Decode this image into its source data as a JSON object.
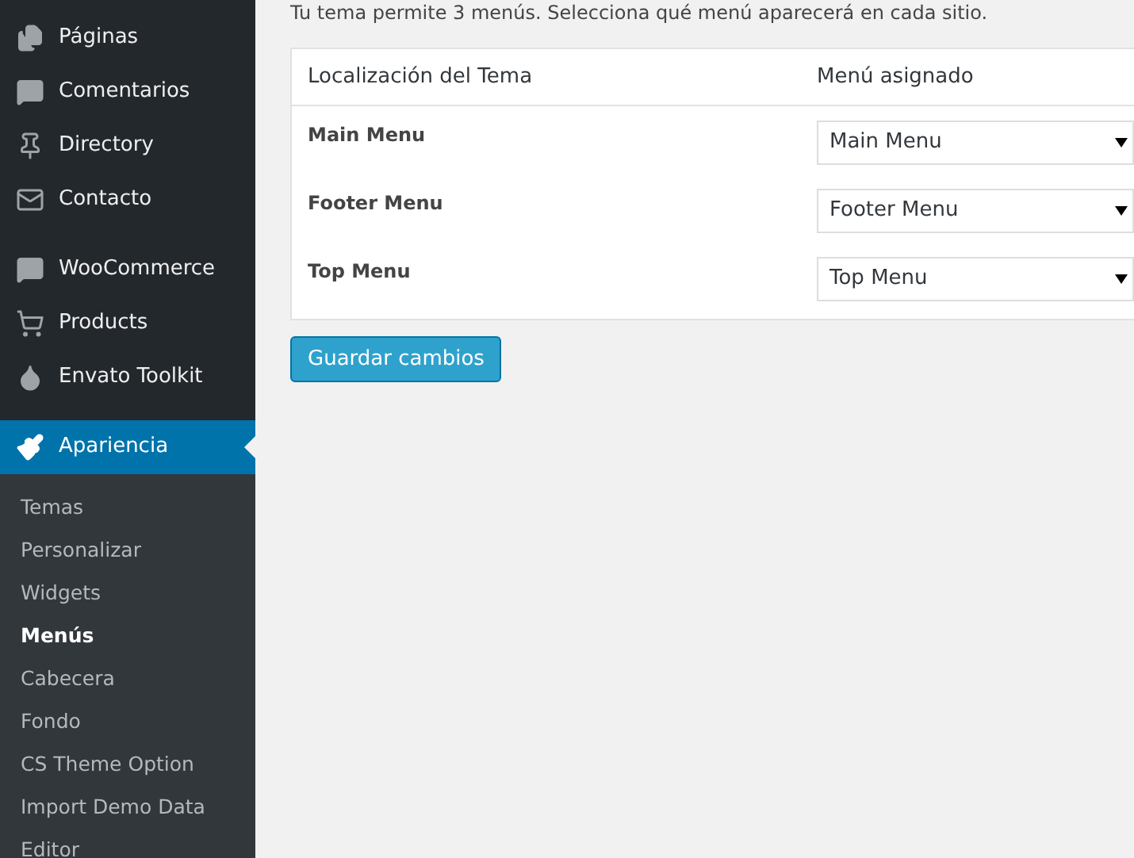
{
  "sidebar": {
    "groups": [
      [
        {
          "label": "Páginas",
          "selected": false
        },
        {
          "label": "Comentarios",
          "selected": false
        },
        {
          "label": "Directory",
          "selected": false
        },
        {
          "label": "Contacto",
          "selected": false
        }
      ],
      [
        {
          "label": "WooCommerce",
          "selected": false
        },
        {
          "label": "Products",
          "selected": false
        },
        {
          "label": "Envato Toolkit",
          "selected": false
        }
      ],
      [
        {
          "label": "Apariencia",
          "selected": true
        }
      ]
    ],
    "submenu": [
      {
        "label": "Temas",
        "selected": false
      },
      {
        "label": "Personalizar",
        "selected": false
      },
      {
        "label": "Widgets",
        "selected": false
      },
      {
        "label": "Menús",
        "selected": true
      },
      {
        "label": "Cabecera",
        "selected": false
      },
      {
        "label": "Fondo",
        "selected": false
      },
      {
        "label": "CS Theme Option",
        "selected": false
      },
      {
        "label": "Import Demo Data",
        "selected": false
      },
      {
        "label": "Editor",
        "selected": false
      }
    ]
  },
  "intro": "Tu tema permite 3 menús. Selecciona qué menú aparecerá en cada sitio.",
  "table": {
    "columns": [
      "Localización del Tema",
      "Menú asignado"
    ],
    "rows": [
      {
        "location": "Main Menu",
        "menu": "Main Menu"
      },
      {
        "location": "Footer Menu",
        "menu": "Footer Menu"
      },
      {
        "location": "Top Menu",
        "menu": "Top Menu"
      }
    ]
  },
  "save_button": "Guardar cambios"
}
